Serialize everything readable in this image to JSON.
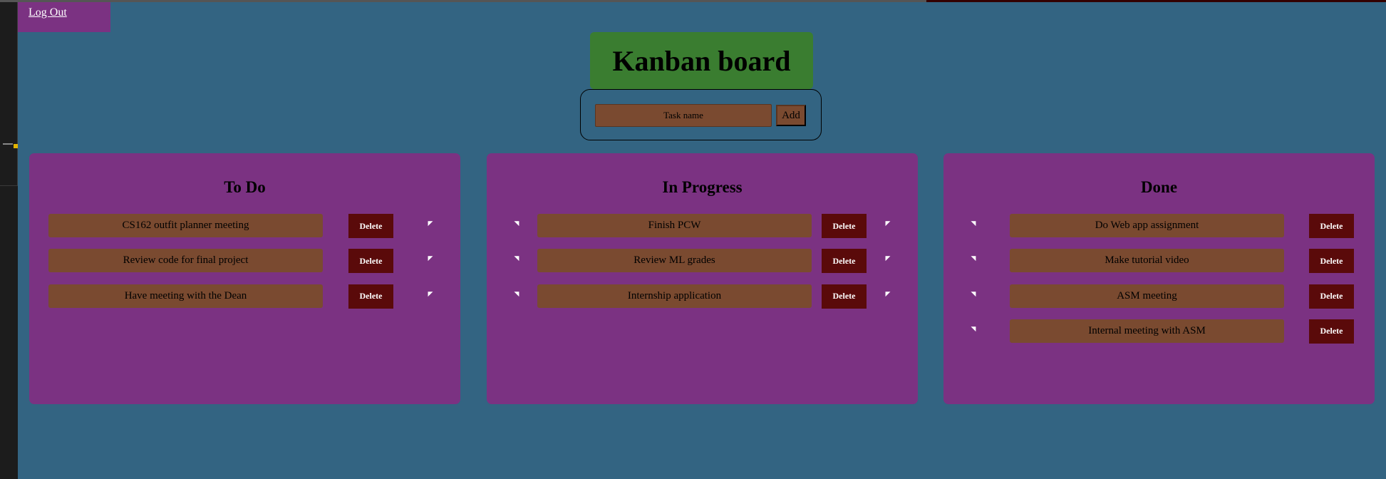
{
  "header": {
    "logout_label": "Log Out",
    "title": "Kanban board"
  },
  "add_form": {
    "placeholder": "Task name",
    "add_label": "Add"
  },
  "delete_label": "Delete",
  "arrow_right": "◤",
  "arrow_left": "◥",
  "columns": [
    {
      "title": "To Do",
      "tasks": [
        "CS162 outfit planner meeting",
        "Review code for final project",
        "Have meeting with the Dean"
      ]
    },
    {
      "title": "In Progress",
      "tasks": [
        "Finish PCW",
        "Review ML grades",
        "Internship application"
      ]
    },
    {
      "title": "Done",
      "tasks": [
        "Do Web app assignment",
        "Make tutorial video",
        "ASM meeting",
        "Internal meeting with ASM"
      ]
    }
  ]
}
